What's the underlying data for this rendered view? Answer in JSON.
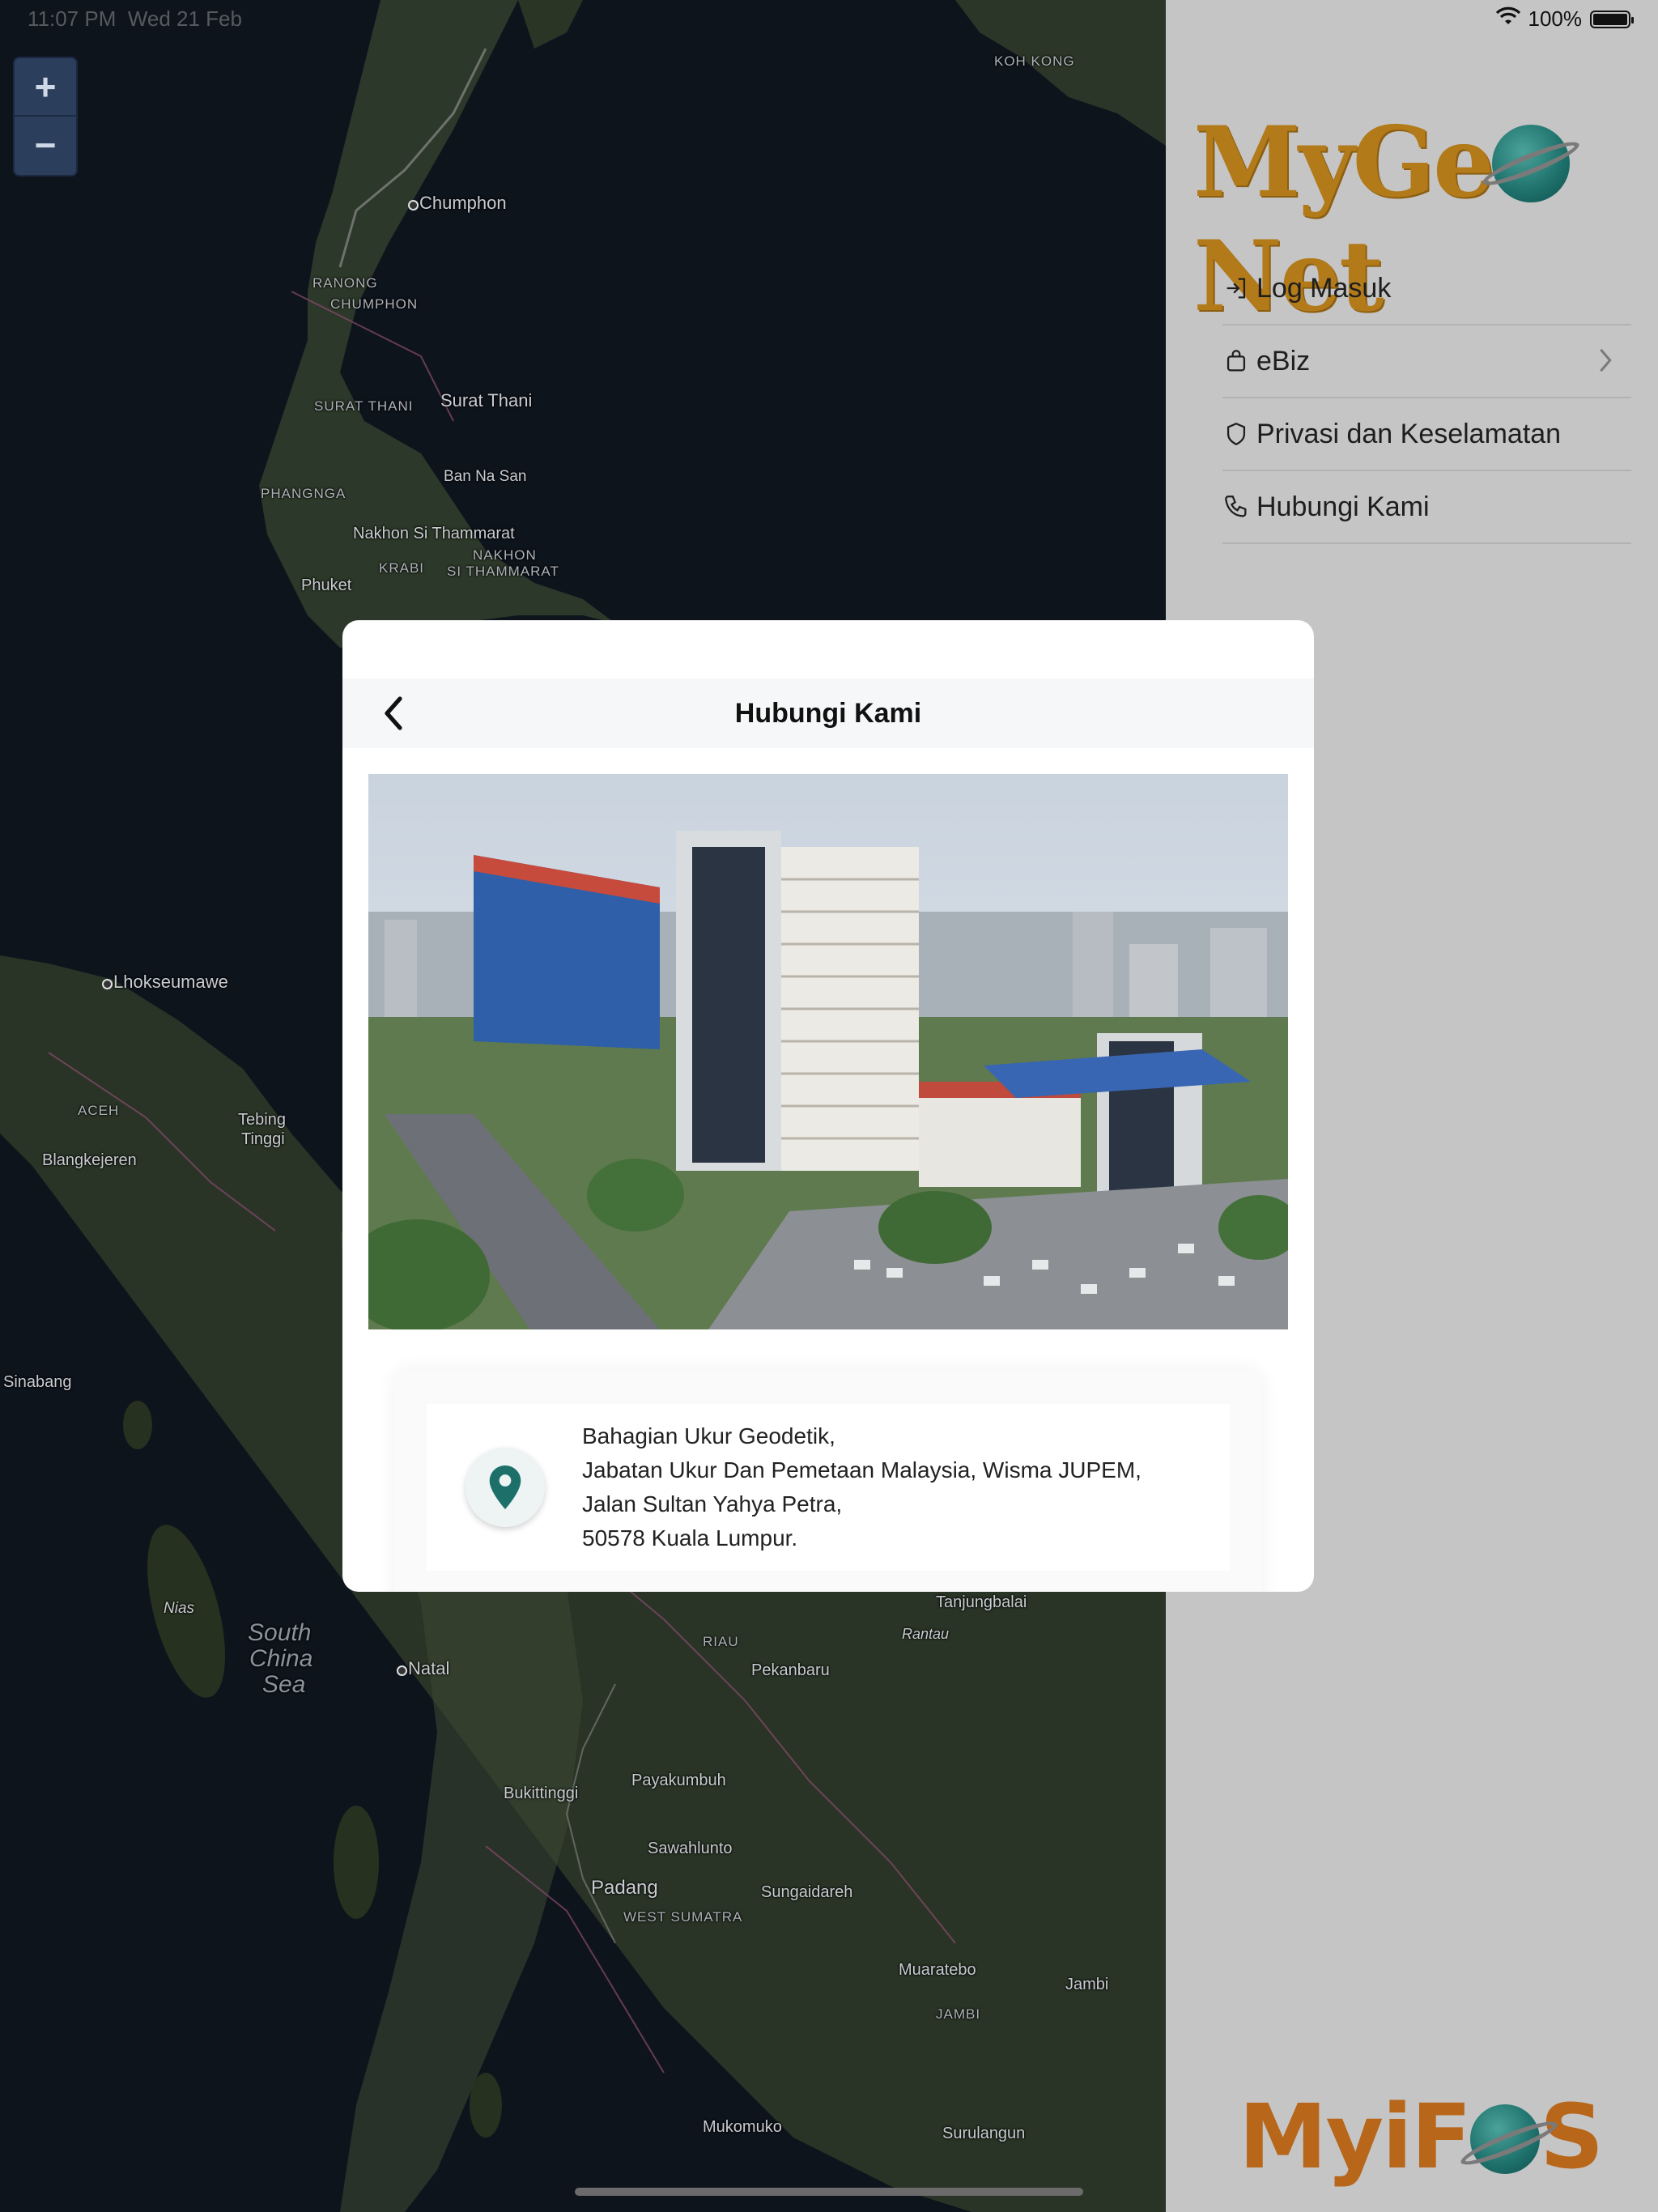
{
  "status_bar": {
    "time": "11:07 PM",
    "date": "Wed 21 Feb",
    "battery": "100%"
  },
  "map": {
    "zoom_in": "+",
    "zoom_out": "−",
    "labels": [
      {
        "text": "Chumphon"
      },
      {
        "text": "RANONG"
      },
      {
        "text": "CHUMPHON"
      },
      {
        "text": "SURAT THANI"
      },
      {
        "text": "Surat Thani"
      },
      {
        "text": "Ban Na San"
      },
      {
        "text": "PHANGNGA"
      },
      {
        "text": "Nakhon Si Thammarat"
      },
      {
        "text": "NAKHON"
      },
      {
        "text": "SI THAMMARAT"
      },
      {
        "text": "KRABI"
      },
      {
        "text": "Phuket"
      },
      {
        "text": "KOH KONG"
      },
      {
        "text": "Lhokseumawe"
      },
      {
        "text": "ACEH"
      },
      {
        "text": "Tebing"
      },
      {
        "text": "Tinggi"
      },
      {
        "text": "Blangkejeren"
      },
      {
        "text": "Sinabang"
      },
      {
        "text": "Nias"
      },
      {
        "text": "South"
      },
      {
        "text": "China"
      },
      {
        "text": "Sea"
      },
      {
        "text": "Natal"
      },
      {
        "text": "Tanjungbalai"
      },
      {
        "text": "Rantau"
      },
      {
        "text": "RIAU"
      },
      {
        "text": "Pekanbaru"
      },
      {
        "text": "Bukittinggi"
      },
      {
        "text": "Payakumbuh"
      },
      {
        "text": "Sawahlunto"
      },
      {
        "text": "Padang"
      },
      {
        "text": "Sungaidareh"
      },
      {
        "text": "WEST SUMATRA"
      },
      {
        "text": "Muaratebo"
      },
      {
        "text": "Jambi"
      },
      {
        "text": "JAMBI"
      },
      {
        "text": "Mukomuko"
      },
      {
        "text": "Surulangun"
      }
    ]
  },
  "sidebar": {
    "logo_top": {
      "part1": "MyGe",
      "part2": "Net"
    },
    "items": [
      {
        "label": "Log Masuk",
        "icon": "login-icon"
      },
      {
        "label": "eBiz",
        "icon": "shopping-bag-icon"
      },
      {
        "label": "Privasi dan Keselamatan",
        "icon": "shield-icon"
      },
      {
        "label": "Hubungi Kami",
        "icon": "phone-icon"
      }
    ],
    "logo_bottom": {
      "part1": "MyiF",
      "part2": "S"
    }
  },
  "modal": {
    "title": "Hubungi Kami",
    "address_lines": [
      "Bahagian Ukur Geodetik,",
      "Jabatan Ukur Dan Pemetaan Malaysia, Wisma JUPEM,",
      "Jalan Sultan Yahya Petra,",
      "50578 Kuala Lumpur."
    ]
  },
  "colors": {
    "accent_teal": "#1d6f6a",
    "brand_orange": "#b37a1a",
    "sidebar_bg": "#c5c5c5"
  }
}
